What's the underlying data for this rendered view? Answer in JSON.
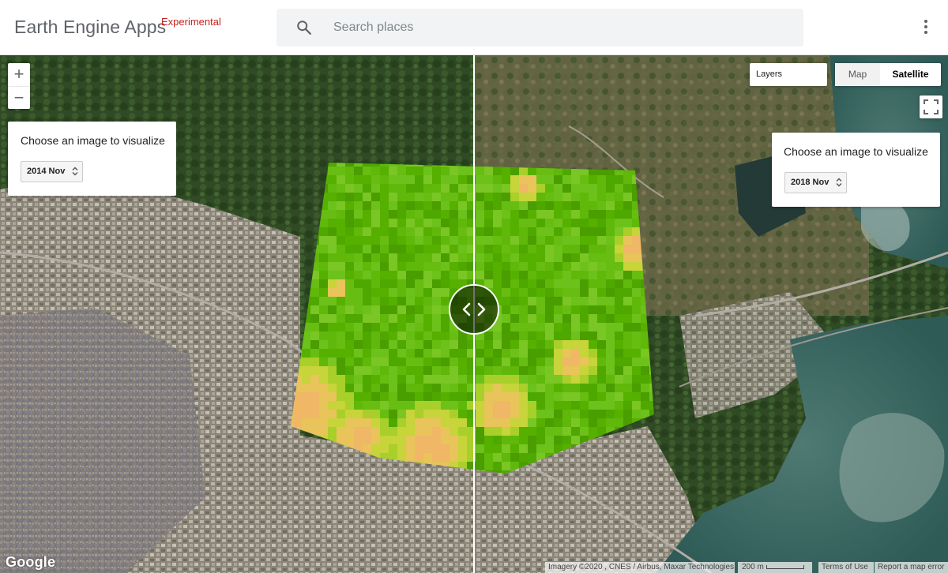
{
  "app": {
    "title": "Earth Engine Apps",
    "tag": "Experimental"
  },
  "search": {
    "placeholder": "Search places",
    "icon": "search-icon"
  },
  "menu": {
    "icon": "more-vert-icon"
  },
  "zoom": {
    "in_label": "+",
    "out_label": "−"
  },
  "left_panel": {
    "title": "Choose an image to visualize",
    "selected": "2014 Nov"
  },
  "right_panel": {
    "title": "Choose an image to visualize",
    "selected": "2018 Nov"
  },
  "map_controls": {
    "layers_label": "Layers",
    "map_label": "Map",
    "satellite_label": "Satellite",
    "active_type": "Satellite"
  },
  "footer": {
    "logo": "Google",
    "attribution": "Imagery ©2020 , CNES / Airbus, Maxar Technologies",
    "scale": "200 m",
    "terms": "Terms of Use",
    "report": "Report a map error"
  },
  "colors": {
    "accent_tag": "#c5221f",
    "ndvi_high": "#4caf00",
    "ndvi_low": "#f2b26b"
  }
}
